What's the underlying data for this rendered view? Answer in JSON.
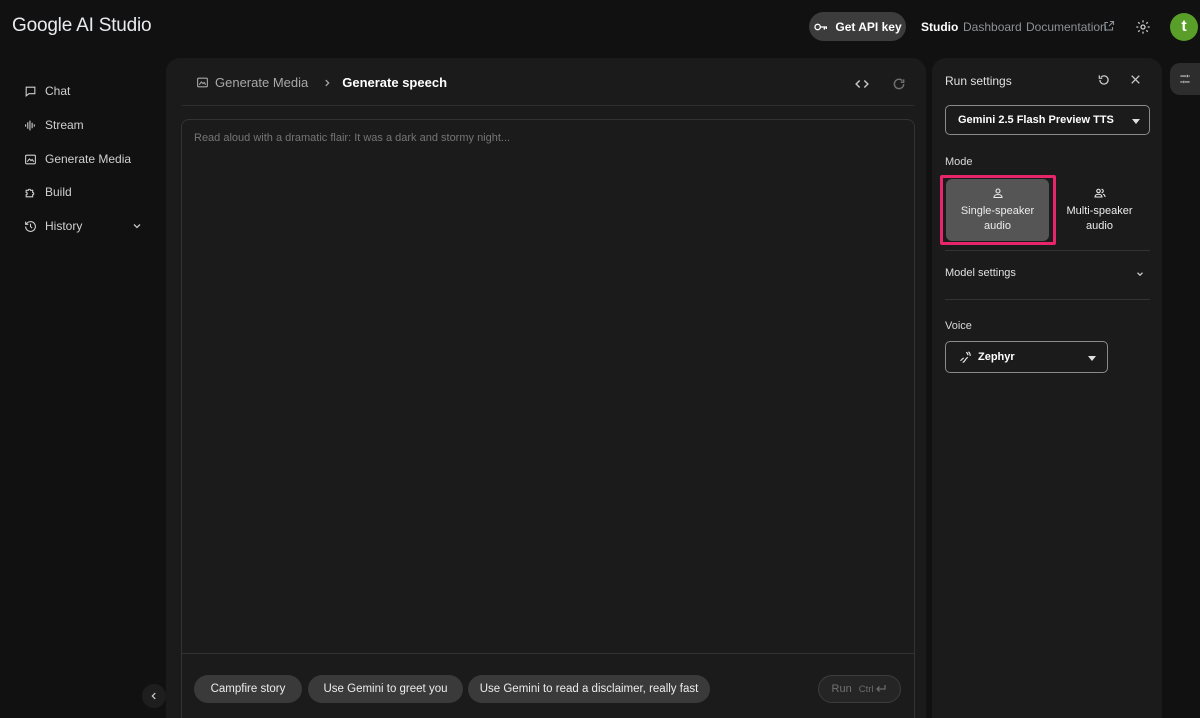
{
  "app": {
    "title": "Google AI Studio"
  },
  "header": {
    "api_key_label": "Get API key",
    "nav": {
      "studio": "Studio",
      "dashboard": "Dashboard",
      "documentation": "Documentation"
    },
    "avatar_initial": "t"
  },
  "sidebar": {
    "items": [
      {
        "label": "Chat",
        "icon": "chat-icon"
      },
      {
        "label": "Stream",
        "icon": "stream-icon"
      },
      {
        "label": "Generate Media",
        "icon": "image-icon"
      },
      {
        "label": "Build",
        "icon": "build-icon"
      },
      {
        "label": "History",
        "icon": "history-icon"
      }
    ]
  },
  "main": {
    "breadcrumb": {
      "parent": "Generate Media",
      "current": "Generate speech"
    },
    "prompt_placeholder": "Read aloud with a dramatic flair: It was a dark and stormy night...",
    "suggestions": [
      "Campfire story",
      "Use Gemini to greet you",
      "Use Gemini to read a disclaimer, really fast"
    ],
    "run": {
      "label": "Run",
      "shortcut": "Ctrl"
    }
  },
  "settings": {
    "title": "Run settings",
    "model": "Gemini 2.5 Flash Preview TTS",
    "mode_label": "Mode",
    "modes": {
      "single": "Single-speaker audio",
      "multi": "Multi-speaker audio"
    },
    "model_settings_label": "Model settings",
    "voice_label": "Voice",
    "voice": "Zephyr"
  },
  "colors": {
    "highlight": "#e8246a",
    "avatar": "#5a9e2a"
  }
}
